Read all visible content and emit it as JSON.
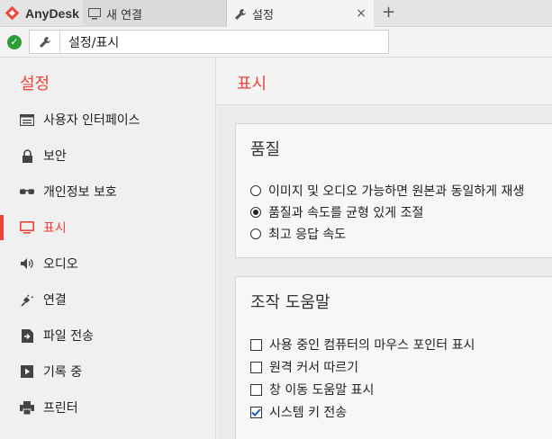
{
  "app": {
    "brand": "AnyDesk",
    "accent": "#ef443b"
  },
  "tabs": [
    {
      "label": "새 연결",
      "icon": "monitor-icon"
    },
    {
      "label": "설정",
      "icon": "wrench-icon",
      "close": "×"
    }
  ],
  "tab_add": "+",
  "address": {
    "status_icon": "check-circle-icon",
    "text": "설정/표시",
    "icon": "wrench-icon"
  },
  "sidebar": {
    "title": "설정",
    "items": [
      {
        "label": "사용자 인터페이스",
        "icon": "window-icon"
      },
      {
        "label": "보안",
        "icon": "lock-icon"
      },
      {
        "label": "개인정보 보호",
        "icon": "glasses-icon"
      },
      {
        "label": "표시",
        "icon": "monitor-icon",
        "active": true
      },
      {
        "label": "오디오",
        "icon": "speaker-icon"
      },
      {
        "label": "연결",
        "icon": "plug-icon"
      },
      {
        "label": "파일 전송",
        "icon": "file-transfer-icon"
      },
      {
        "label": "기록 중",
        "icon": "record-icon"
      },
      {
        "label": "프린터",
        "icon": "printer-icon"
      }
    ]
  },
  "main": {
    "title": "표시",
    "quality": {
      "title": "품질",
      "options": [
        {
          "label": "이미지 및 오디오 가능하면 원본과 동일하게 재생",
          "selected": false
        },
        {
          "label": "품질과 속도를 균형 있게 조절",
          "selected": true
        },
        {
          "label": "최고 응답 속도",
          "selected": false
        }
      ]
    },
    "help": {
      "title": "조작 도움말",
      "options": [
        {
          "label": "사용 중인 컴퓨터의 마우스 포인터 표시",
          "checked": false
        },
        {
          "label": "원격 커서 따르기",
          "checked": false
        },
        {
          "label": "창 이동 도움말 표시",
          "checked": false
        },
        {
          "label": "시스템 키 전송",
          "checked": true
        }
      ]
    }
  }
}
